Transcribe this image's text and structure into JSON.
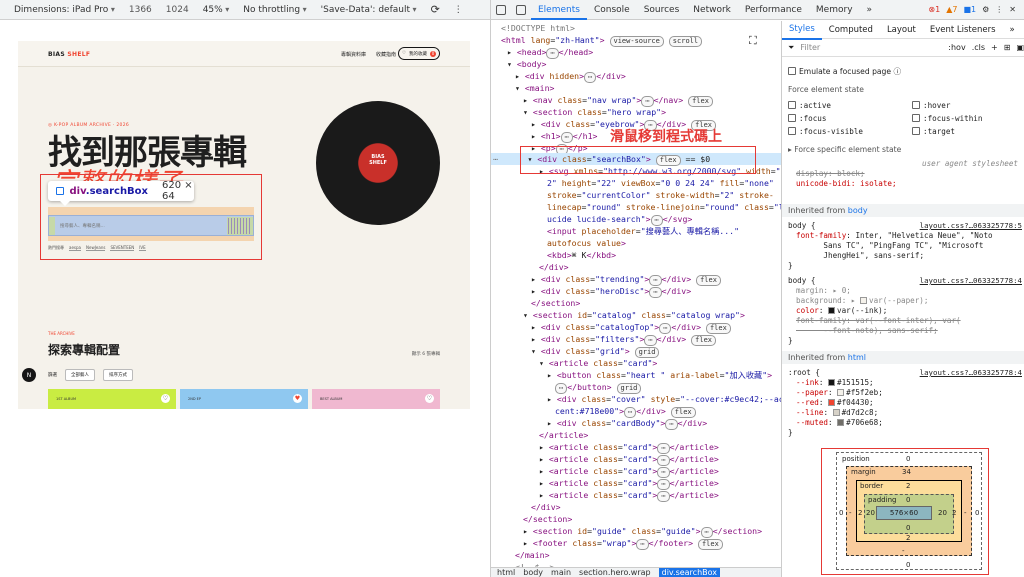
{
  "device_toolbar": {
    "dimensions": "Dimensions: iPad Pro",
    "width": "1366",
    "height": "1024",
    "zoom": "45%",
    "throttle": "No throttling",
    "save_data": "'Save-Data': default"
  },
  "page": {
    "logo_a": "BIAS",
    "logo_b": "SHELF",
    "nav_links": [
      "專輯資料庫",
      "收藏指南"
    ],
    "nav_button": "我的收藏",
    "nav_count": "0",
    "eyebrow": "◎ K-POP ALBUM ARCHIVE · 2026",
    "h1_line1": "找到那張專輯",
    "h1_line2": "完整的樣子。",
    "search_placeholder": "搜尋藝人、專輯名稱...",
    "trending_label": "熱門搜尋",
    "trending": [
      "aespa",
      "NewJeans",
      "SEVENTEEN",
      "IVE"
    ],
    "disc_label": "BIAS SHELF",
    "section_eyebrow": "THE ARCHIVE",
    "section_title": "探索專輯配置",
    "section_count": "顯示 6 張專輯",
    "filter_label": "篩選",
    "filter_1": "全部藝人",
    "filter_2": "排序方式",
    "cards": [
      "1ST ALBUM",
      "2ND EP",
      "BEST ALBUM"
    ],
    "badge": "N"
  },
  "tooltip": {
    "tag": "div",
    "cls": ".searchBox",
    "size": "620 × 64"
  },
  "caption": "滑鼠移到程式碼上",
  "devtools": {
    "tabs": [
      "Elements",
      "Console",
      "Sources",
      "Network",
      "Performance",
      "Memory"
    ],
    "more": "»",
    "errors": "1",
    "warnings": "7",
    "info": "1",
    "breadcrumbs": [
      "html",
      "body",
      "main",
      "section.hero.wrap",
      "div.searchBox"
    ]
  },
  "styles": {
    "tabs": [
      "Styles",
      "Computed",
      "Layout",
      "Event Listeners",
      "»"
    ],
    "filter": "Filter",
    "hov": ":hov",
    "cls": ".cls",
    "emulate": "Emulate a focused page",
    "force_state": "Force element state",
    "states_left": [
      ":active",
      ":focus",
      ":focus-visible"
    ],
    "states_right": [
      ":hover",
      ":focus-within",
      ":target"
    ],
    "force_specific": "▸ Force specific element state",
    "ua_label": "user agent stylesheet",
    "ua_prop1": "display: block;",
    "ua_prop2": "unicode-bidi: isolate;",
    "inherited_body": "body",
    "inherited_html": "html",
    "inherited_from": "Inherited from",
    "src1": "layout.css?…063325778:5",
    "src2": "layout.css?…063325778:4",
    "src3": "layout.css?…063325778:4",
    "colors": {
      "ink": "#151515",
      "paper": "#f5f2eb",
      "red": "#f04430",
      "line": "#d7d2c8",
      "muted": "#706e68"
    }
  },
  "boxmodel": {
    "position": "position",
    "position_val": "0",
    "margin": "margin",
    "margin_top": "34",
    "margin_val": "-",
    "border": "border",
    "border_val": "2",
    "padding": "padding",
    "padding_top": "0",
    "padding_side": "20",
    "content": "576×60",
    "left": "0",
    "right": "0",
    "bottom": "0"
  }
}
